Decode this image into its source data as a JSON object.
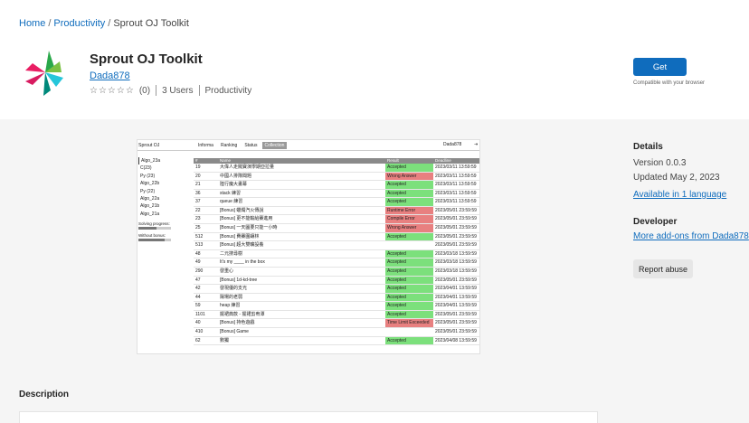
{
  "breadcrumb": {
    "home": "Home",
    "category": "Productivity",
    "current": "Sprout OJ Toolkit"
  },
  "extension": {
    "title": "Sprout OJ Toolkit",
    "author": "Dada878",
    "stars": "☆☆☆☆☆",
    "rating_count": "(0)",
    "users": "3 Users",
    "category": "Productivity"
  },
  "actions": {
    "get_label": "Get",
    "compatibility": "Compatible with your browser"
  },
  "screenshot": {
    "app_name": "Sprout OJ",
    "tabs": [
      "Informa",
      "Ranking",
      "Status",
      "Collection"
    ],
    "active_tab": 3,
    "user": "Dada878",
    "user_icon": "⇥",
    "sidebar": [
      "Algo_23a",
      "C(23)",
      "Py (23)",
      "Algo_22b",
      "Py (22)",
      "Algo_22a",
      "Algo_21b",
      "Algo_21a"
    ],
    "progress": [
      {
        "label": "Solving progress:",
        "value": 0.55
      },
      {
        "label": "Without bonus:",
        "value": 0.8
      }
    ],
    "columns": [
      "#",
      "Name",
      "Result",
      "Deadline"
    ],
    "rows": [
      {
        "id": "19",
        "name": "大偉人走闖寶演學期亞拉量",
        "result": "Accepted",
        "status": "accepted",
        "deadline": "2023/03/11 13:59:59"
      },
      {
        "id": "20",
        "name": "中國人排隊聞題",
        "result": "Wrong Answer",
        "status": "bad",
        "deadline": "2023/03/11 13:59:59"
      },
      {
        "id": "21",
        "name": "陸行魔大畫幕",
        "result": "Accepted",
        "status": "accepted",
        "deadline": "2023/03/11 13:59:59"
      },
      {
        "id": "36",
        "name": "stack 練習",
        "result": "Accepted",
        "status": "accepted",
        "deadline": "2023/03/11 13:59:59"
      },
      {
        "id": "37",
        "name": "queue 練習",
        "result": "Accepted",
        "status": "accepted",
        "deadline": "2023/03/11 13:59:59"
      },
      {
        "id": "22",
        "name": "[Bonus] 蠟燭汽火傳說",
        "result": "Runtime Error",
        "status": "bad",
        "deadline": "2023/05/01 23:59:59"
      },
      {
        "id": "23",
        "name": "[Bonus] 更不能輸給賽進用",
        "result": "Compile Error",
        "status": "bad",
        "deadline": "2023/05/01 23:59:59"
      },
      {
        "id": "25",
        "name": "[Bonus] 一天圖要只能一小時",
        "result": "Wrong Answer",
        "status": "bad",
        "deadline": "2023/05/01 23:59:59"
      },
      {
        "id": "512",
        "name": "[Bonus] 費賽圍鑲林",
        "result": "Accepted",
        "status": "accepted",
        "deadline": "2023/05/01 23:59:59"
      },
      {
        "id": "513",
        "name": "[Bonus] 超大雙曠設養",
        "result": "",
        "status": "none",
        "deadline": "2023/05/01 23:59:59"
      },
      {
        "id": "48",
        "name": "二元搜尋樹",
        "result": "Accepted",
        "status": "accepted",
        "deadline": "2023/03/18 13:59:59"
      },
      {
        "id": "49",
        "name": "It's my ____ in the box",
        "result": "Accepted",
        "status": "accepted",
        "deadline": "2023/03/18 13:59:59"
      },
      {
        "id": "290",
        "name": "發重心",
        "result": "Accepted",
        "status": "accepted",
        "deadline": "2023/03/18 13:59:59"
      },
      {
        "id": "47",
        "name": "[Bonus] 1d-kd-tree",
        "result": "Accepted",
        "status": "accepted",
        "deadline": "2023/05/01 23:59:59"
      },
      {
        "id": "42",
        "name": "發現優的支光",
        "result": "Accepted",
        "status": "accepted",
        "deadline": "2023/04/01 13:59:59"
      },
      {
        "id": "44",
        "name": "陽場的老弱",
        "result": "Accepted",
        "status": "accepted",
        "deadline": "2023/04/01 13:59:59"
      },
      {
        "id": "59",
        "name": "heap 練習",
        "result": "Accepted",
        "status": "accepted",
        "deadline": "2023/04/01 13:59:59"
      },
      {
        "id": "1101",
        "name": "擺裙典款 - 擺裙剪宥潭",
        "result": "Accepted",
        "status": "accepted",
        "deadline": "2023/05/01 23:59:59"
      },
      {
        "id": "40",
        "name": "[Bonus] 持色遊戲",
        "result": "Time Limit Exceeded",
        "status": "bad",
        "deadline": "2023/05/01 23:59:59"
      },
      {
        "id": "410",
        "name": "[Bonus] Game",
        "result": "",
        "status": "none",
        "deadline": "2023/05/01 23:59:59"
      },
      {
        "id": "62",
        "name": "數獨",
        "result": "Accepted",
        "status": "accepted",
        "deadline": "2023/04/08 13:59:59"
      }
    ]
  },
  "details": {
    "heading": "Details",
    "version": "Version 0.0.3",
    "updated": "Updated May 2, 2023",
    "languages": "Available in 1 language"
  },
  "developer": {
    "heading": "Developer",
    "more": "More add-ons from Dada878"
  },
  "report_label": "Report abuse",
  "description_heading": "Description",
  "colors": {
    "accent": "#0f6cbd",
    "accepted": "#7ce07c",
    "error": "#e88080"
  }
}
